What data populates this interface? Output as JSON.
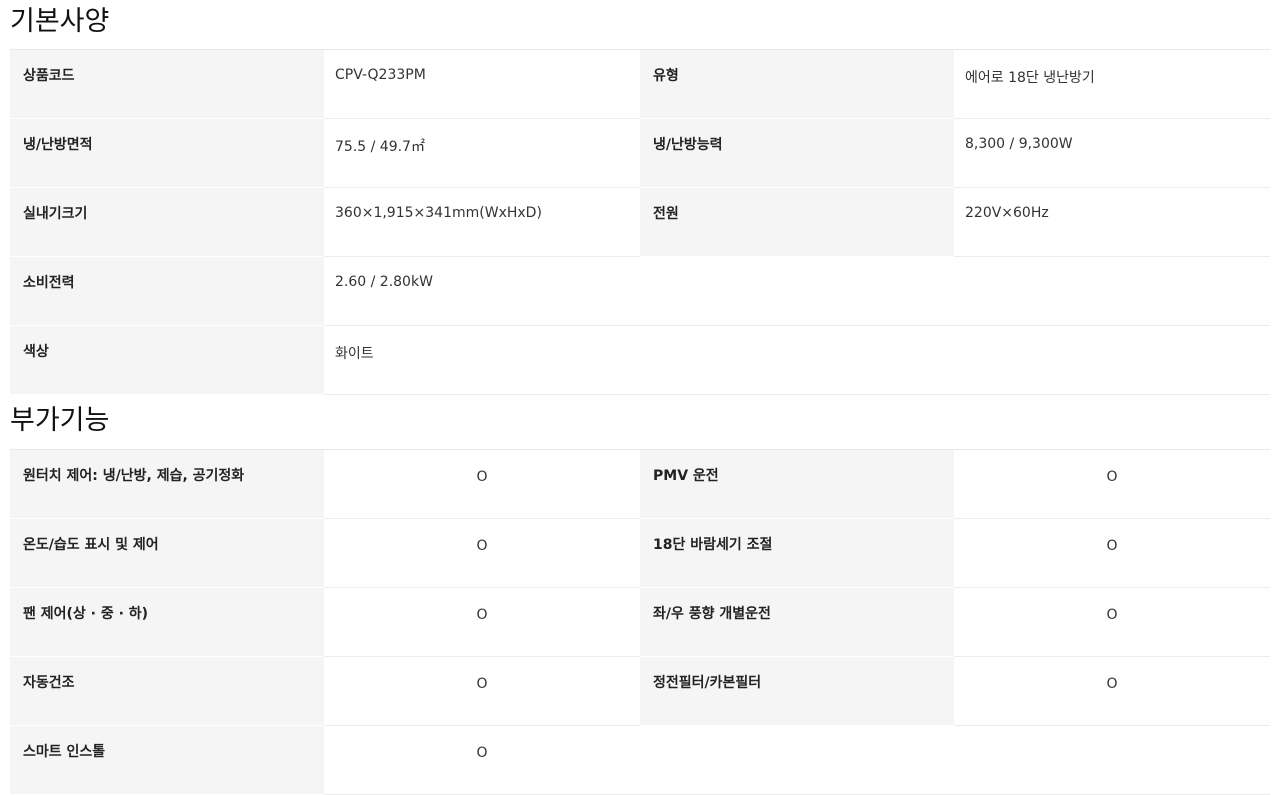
{
  "basic": {
    "title": "기본사양",
    "rows": [
      {
        "label1": "상품코드",
        "value1": "CPV-Q233PM",
        "label2": "유형",
        "value2": "에어로 18단 냉난방기"
      },
      {
        "label1": "냉/난방면적",
        "value1": "75.5 / 49.7㎡",
        "label2": "냉/난방능력",
        "value2": "8,300 / 9,300W"
      },
      {
        "label1": "실내기크기",
        "value1": "360×1,915×341mm(WxHxD)",
        "label2": "전원",
        "value2": "220V×60Hz"
      },
      {
        "label1": "소비전력",
        "value1": "2.60 / 2.80kW"
      },
      {
        "label1": "색상",
        "value1": "화이트"
      }
    ]
  },
  "extra": {
    "title": "부가기능",
    "rows": [
      {
        "label1": "원터치 제어: 냉/난방, 제습, 공기정화",
        "value1": "O",
        "label2": "PMV 운전",
        "value2": "O"
      },
      {
        "label1": "온도/습도 표시 및 제어",
        "value1": "O",
        "label2": "18단 바람세기 조절",
        "value2": "O"
      },
      {
        "label1": "팬 제어(상 · 중 · 하)",
        "value1": "O",
        "label2": "좌/우 풍향 개별운전",
        "value2": "O"
      },
      {
        "label1": "자동건조",
        "value1": "O",
        "label2": "정전필터/카본필터",
        "value2": "O"
      },
      {
        "label1": "스마트 인스톨",
        "value1": "O"
      }
    ]
  }
}
